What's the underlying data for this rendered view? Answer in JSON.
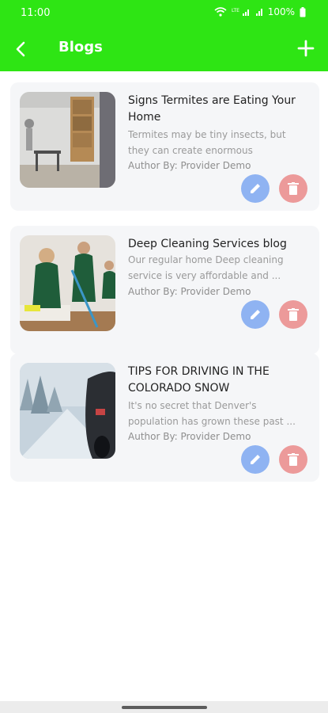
{
  "status_bar": {
    "time": "11:00",
    "battery_percent": "100%"
  },
  "app_bar": {
    "title": "Blogs"
  },
  "blogs": [
    {
      "title": "Signs Termites are Eating Your Home",
      "description": "Termites may be tiny insects, but they can create enormous problem...",
      "author": "Author By: Provider Demo"
    },
    {
      "title": "Deep Cleaning Services blog",
      "description": "Our regular home Deep cleaning service is very affordable and ...",
      "author": "Author By: Provider Demo"
    },
    {
      "title": "TIPS FOR DRIVING IN THE COLORADO SNOW",
      "description": "It's no secret that Denver's population has grown these past ...",
      "author": "Author By: Provider Demo"
    }
  ],
  "colors": {
    "brand_green": "#2ee514",
    "edit_blue": "#8fb3f2",
    "delete_red": "#ec9a9a"
  },
  "icons": {
    "back": "arrow-left-icon",
    "add": "plus-icon",
    "edit": "pencil-icon",
    "delete": "trash-icon"
  }
}
